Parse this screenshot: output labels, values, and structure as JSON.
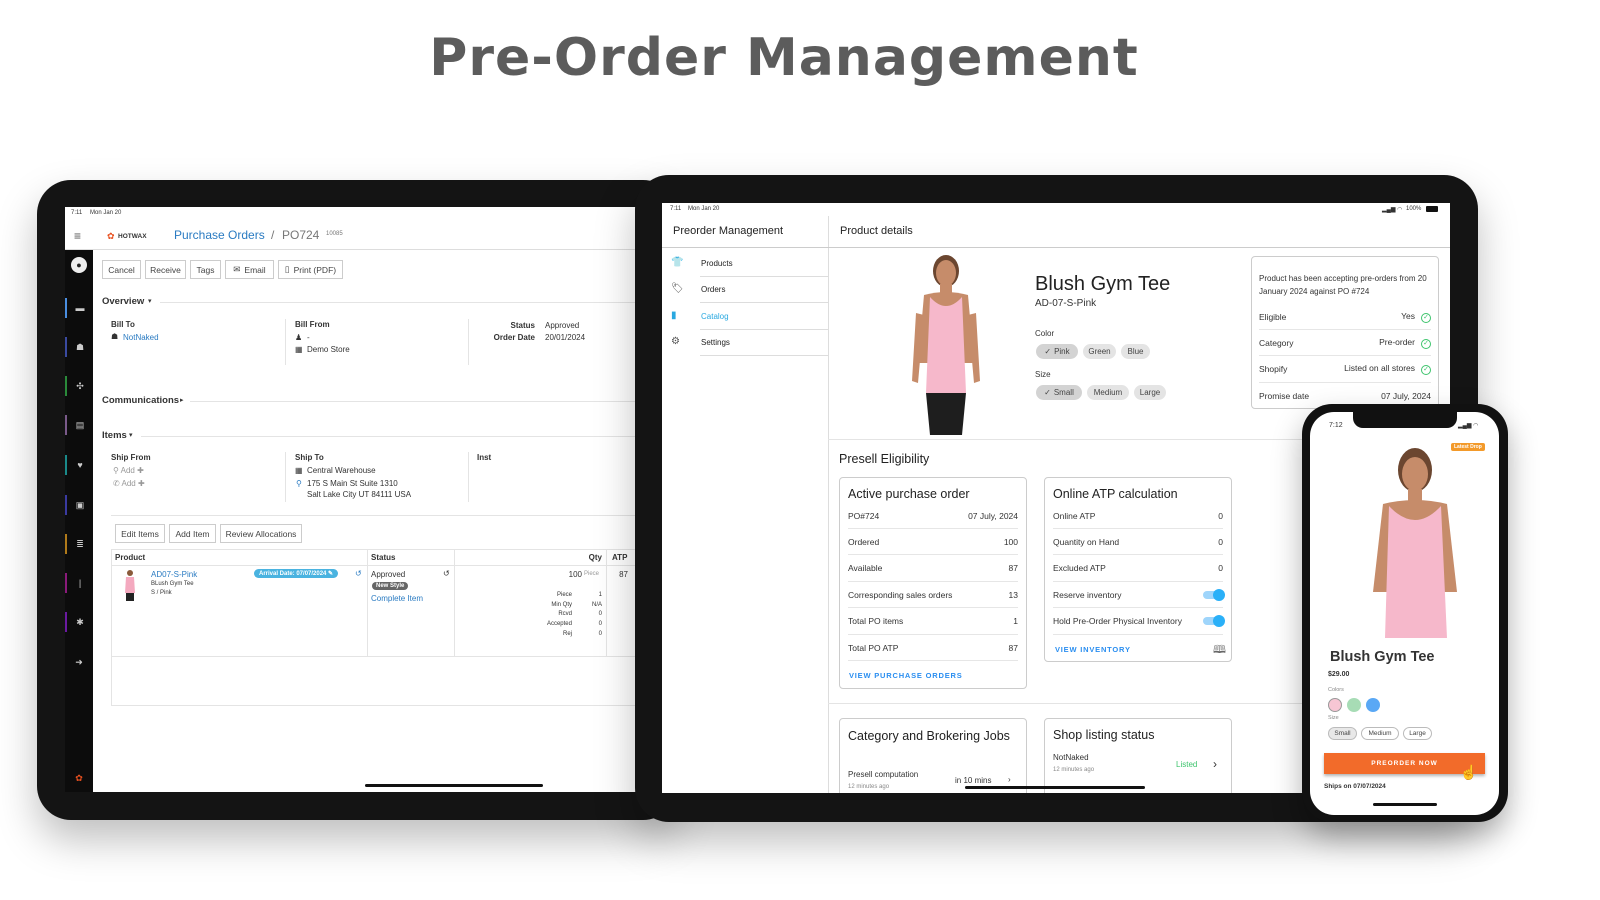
{
  "page_title": "Pre-Order Management",
  "left_tablet": {
    "status_time": "7:11",
    "status_date": "Mon Jan 20",
    "logo_text": "HOTWAX",
    "breadcrumb": {
      "parent": "Purchase Orders",
      "separator": "/",
      "current": "PO724",
      "id": "10085"
    },
    "toolbar": {
      "cancel": "Cancel",
      "receive": "Receive",
      "tags": "Tags",
      "email": "Email",
      "print": "Print (PDF)"
    },
    "overview": {
      "title": "Overview",
      "bill_to_label": "Bill To",
      "bill_to": "NotNaked",
      "bill_from_label": "Bill From",
      "bill_from_person": "-",
      "bill_from_store": "Demo Store",
      "status_label": "Status",
      "status": "Approved",
      "order_date_label": "Order Date",
      "order_date": "20/01/2024"
    },
    "communications": "Communications",
    "items": {
      "title": "Items",
      "ship_from_label": "Ship From",
      "add1": "Add",
      "add2": "Add",
      "ship_to_label": "Ship To",
      "ship_to_name": "Central Warehouse",
      "address1": "175 S Main St Suite 1310",
      "address2": "Salt Lake City UT 84111 USA",
      "inst_label": "Inst"
    },
    "item_buttons": {
      "edit": "Edit Items",
      "add": "Add Item",
      "review": "Review Allocations"
    },
    "table": {
      "headers": [
        "Product",
        "Status",
        "Qty",
        "ATP"
      ],
      "row": {
        "sku": "AD07-S-Pink",
        "name": "BLush Gym Tee",
        "variant": "S / Pink",
        "arrival": "Arrival Date: 07/07/2024",
        "status": "Approved",
        "badge": "New Style",
        "complete": "Complete Item",
        "qty": "100",
        "unit": "Piece",
        "atp": "87",
        "details": [
          {
            "k": "Piece",
            "v": "1"
          },
          {
            "k": "Min Qty",
            "v": "N/A"
          },
          {
            "k": "Rcvd",
            "v": "0"
          },
          {
            "k": "Accepted",
            "v": "0"
          },
          {
            "k": "Rej",
            "v": "0"
          }
        ]
      }
    }
  },
  "right_tablet": {
    "status_time": "7:11",
    "status_date": "Mon Jan 20",
    "battery": "100%",
    "app_title": "Preorder Management",
    "nav": [
      {
        "label": "Products",
        "icon": "shirt-icon"
      },
      {
        "label": "Orders",
        "icon": "tag-icon"
      },
      {
        "label": "Catalog",
        "icon": "folder-icon"
      },
      {
        "label": "Settings",
        "icon": "gear-icon"
      }
    ],
    "active_nav": "Catalog",
    "accent": "#29a8e0",
    "header": "Product details",
    "product": {
      "name": "Blush Gym Tee",
      "sku": "AD-07-S-Pink",
      "color_label": "Color",
      "colors": [
        "Pink",
        "Green",
        "Blue"
      ],
      "size_label": "Size",
      "sizes": [
        "Small",
        "Medium",
        "Large"
      ]
    },
    "info": {
      "message": "Product has been accepting pre-orders from 20 January 2024 against PO #724",
      "rows": [
        {
          "k": "Eligible",
          "v": "Yes"
        },
        {
          "k": "Category",
          "v": "Pre-order"
        },
        {
          "k": "Shopify",
          "v": "Listed on all stores"
        },
        {
          "k": "Promise date",
          "v": "07 July, 2024"
        }
      ]
    },
    "presell_title": "Presell Eligibility",
    "active_po": {
      "title": "Active purchase order",
      "rows": [
        {
          "k": "PO#724",
          "v": "07 July, 2024"
        },
        {
          "k": "Ordered",
          "v": "100"
        },
        {
          "k": "Available",
          "v": "87"
        },
        {
          "k": "Corresponding sales orders",
          "v": "13"
        },
        {
          "k": "Total PO items",
          "v": "1"
        },
        {
          "k": "Total PO ATP",
          "v": "87"
        }
      ],
      "link": "VIEW PURCHASE ORDERS"
    },
    "atp": {
      "title": "Online ATP calculation",
      "rows": [
        {
          "k": "Online ATP",
          "v": "0"
        },
        {
          "k": "Quantity on Hand",
          "v": "0"
        },
        {
          "k": "Excluded ATP",
          "v": "0"
        }
      ],
      "toggles": [
        {
          "k": "Reserve inventory",
          "on": true
        },
        {
          "k": "Hold Pre-Order Physical Inventory",
          "on": true
        }
      ],
      "link": "VIEW INVENTORY"
    },
    "jobs": {
      "title": "Category and Brokering Jobs",
      "row": "Presell computation",
      "time": "in 10 mins",
      "ago": "12 minutes ago"
    },
    "shop": {
      "title": "Shop listing status",
      "store": "NotNaked",
      "ago": "12 minutes ago",
      "status": "Listed"
    }
  },
  "phone": {
    "status_time": "7:12",
    "badge": "Latest Drop",
    "name": "Blush Gym Tee",
    "price": "$29.00",
    "colors_label": "Colors",
    "swatches": [
      "#f7c6d4",
      "#a7dcb5",
      "#5aa8f5"
    ],
    "size_label": "Size",
    "sizes": [
      "Small",
      "Medium",
      "Large"
    ],
    "cta": "PREORDER NOW",
    "ships": "Ships on 07/07/2024",
    "cta_color": "#f26b2a"
  }
}
